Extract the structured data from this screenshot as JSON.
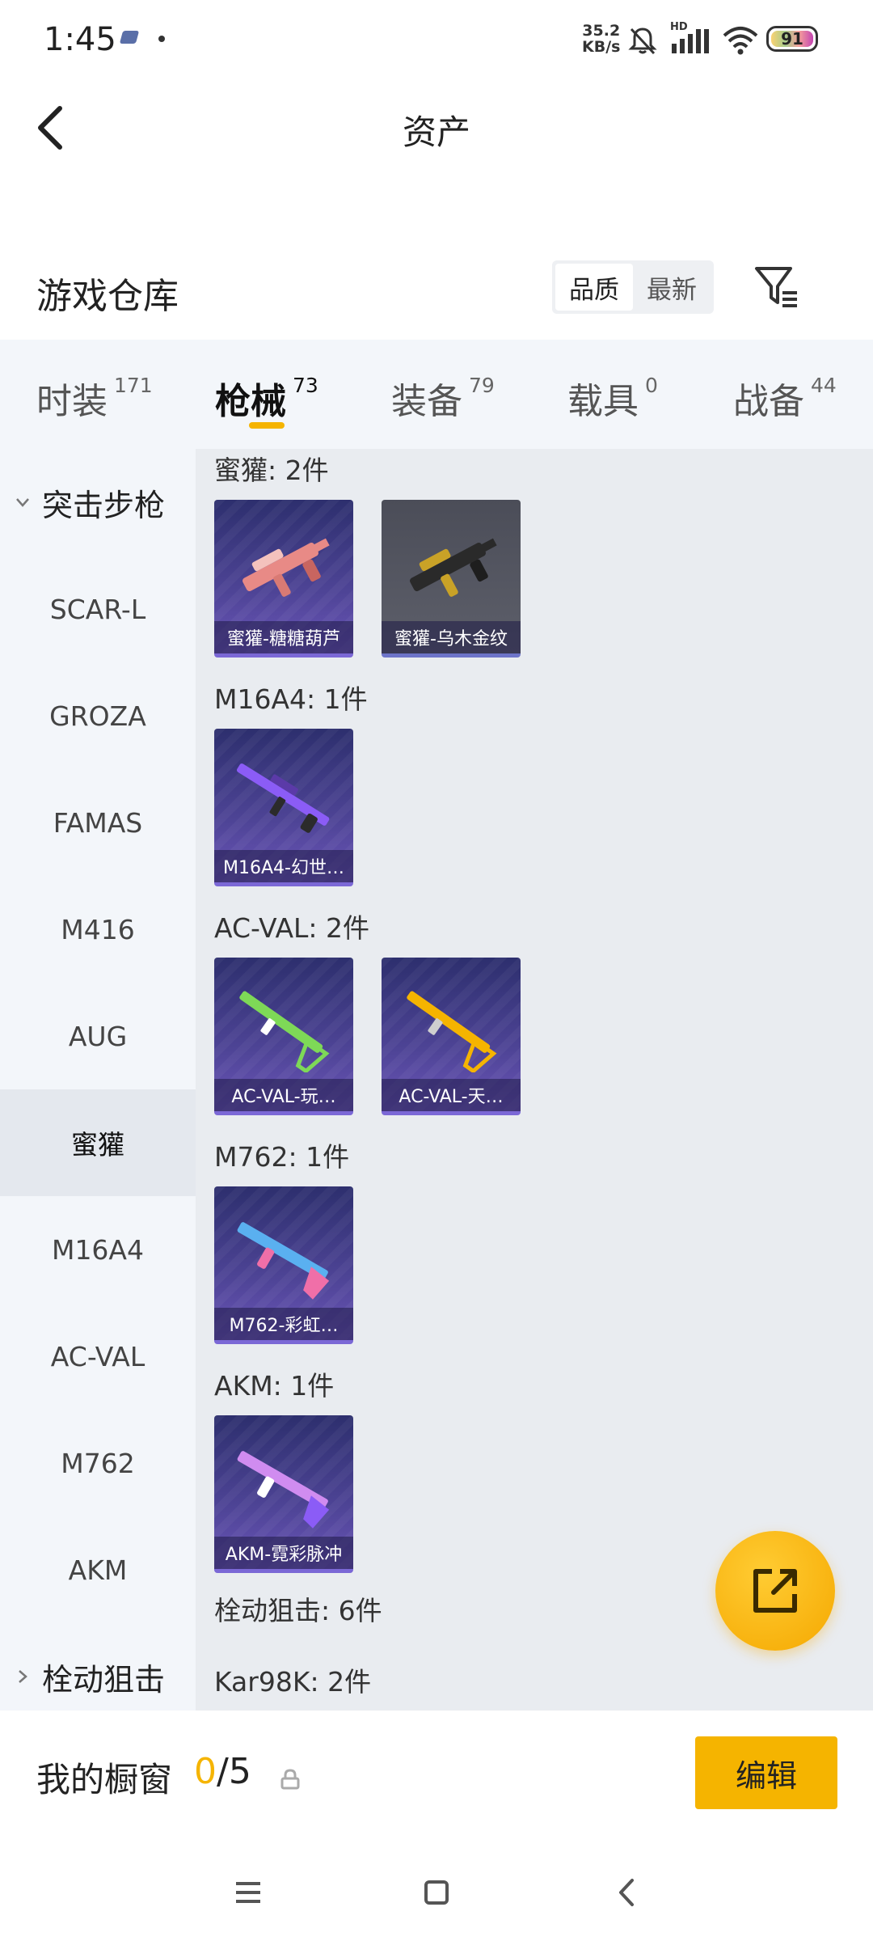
{
  "status_bar": {
    "time": "1:45",
    "net_speed_value": "35.2",
    "net_speed_unit": "KB/s",
    "hd_label": "HD",
    "battery": "91"
  },
  "header": {
    "title": "资产"
  },
  "warehouse": {
    "title": "游戏仓库",
    "sort_options": [
      "品质",
      "最新"
    ],
    "sort_selected": "品质"
  },
  "tabs": [
    {
      "label": "时装",
      "count": "171"
    },
    {
      "label": "枪械",
      "count": "73"
    },
    {
      "label": "装备",
      "count": "79"
    },
    {
      "label": "载具",
      "count": "0"
    },
    {
      "label": "战备",
      "count": "44"
    }
  ],
  "active_tab": "枪械",
  "sidebar": {
    "group_assault": "突击步枪",
    "items": [
      "SCAR-L",
      "GROZA",
      "FAMAS",
      "M416",
      "AUG",
      "蜜獾",
      "M16A4",
      "AC-VAL",
      "M762",
      "AKM"
    ],
    "selected": "蜜獾",
    "group_bolt": "栓动狙击"
  },
  "content": {
    "groups": [
      {
        "title": "蜜獾: 2件",
        "items": [
          {
            "name": "蜜獾-糖糖葫芦",
            "color": "#e88a86"
          },
          {
            "name": "蜜獾-乌木金纹",
            "color": "#c9a227"
          }
        ]
      },
      {
        "title": "M16A4: 1件",
        "items": [
          {
            "name": "M16A4-幻世…",
            "color": "#8b5cf6"
          }
        ]
      },
      {
        "title": "AC-VAL: 2件",
        "items": [
          {
            "name": "AC-VAL-玩…",
            "color": "#7ed957"
          },
          {
            "name": "AC-VAL-天…",
            "color": "#f5b400"
          }
        ]
      },
      {
        "title": "M762: 1件",
        "items": [
          {
            "name": "M762-彩虹…",
            "color": "#5ab0f0"
          }
        ]
      },
      {
        "title": "AKM: 1件",
        "items": [
          {
            "name": "AKM-霓彩脉冲",
            "color": "#d08cf0"
          }
        ]
      }
    ],
    "bolt_title": "栓动狙击: 6件",
    "kar_title": "Kar98K: 2件"
  },
  "showcase": {
    "label": "我的橱窗",
    "count_current": "0",
    "count_total": "/5",
    "edit_label": "编辑"
  },
  "colors": {
    "accent": "#f5b400",
    "card_border": "#7b68d6"
  },
  "icons": [
    "back-icon",
    "filter-icon",
    "share-icon",
    "lock-icon",
    "menu-icon",
    "home-icon",
    "back-nav-icon",
    "wifi-icon",
    "signal-icon",
    "mute-icon"
  ]
}
